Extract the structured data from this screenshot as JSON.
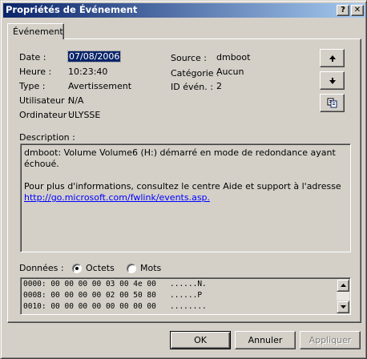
{
  "window": {
    "title": "Propriétés de Événement"
  },
  "titlebar": {
    "help_label": "?",
    "close_label": "✕"
  },
  "tabs": [
    {
      "label": "Événement"
    }
  ],
  "event": {
    "date_label": "Date :",
    "date_value": "07/08/2006",
    "time_label": "Heure :",
    "time_value": "10:23:40",
    "type_label": "Type :",
    "type_value": "Avertissement",
    "user_label": "Utilisateur :",
    "user_value": "N/A",
    "computer_label": "Ordinateur :",
    "computer_value": "ULYSSE",
    "source_label": "Source :",
    "source_value": "dmboot",
    "category_label": "Catégorie :",
    "category_value": "Aucun",
    "event_id_label": "ID évén. :",
    "event_id_value": "2"
  },
  "side_buttons": {
    "up_icon": "arrow-up-icon",
    "down_icon": "arrow-down-icon",
    "copy_icon": "copy-icon"
  },
  "description": {
    "label": "Description :",
    "line1": "dmboot: Volume Volume6 (H:) démarré en mode de redondance ayant échoué.",
    "line2": "Pour plus d'informations, consultez le centre Aide et support à l'adresse",
    "link": "http://go.microsoft.com/fwlink/events.asp."
  },
  "data_section": {
    "label": "Données :",
    "options": [
      {
        "label": "Octets",
        "selected": true
      },
      {
        "label": "Mots",
        "selected": false
      }
    ],
    "rows": [
      "0000: 00 00 00 00 03 00 4e 00   ......N.",
      "0008: 00 00 00 00 02 00 50 80   ......P",
      "0010: 00 00 00 00 00 00 00 00   ........"
    ]
  },
  "footer": {
    "ok": "OK",
    "cancel": "Annuler",
    "apply": "Appliquer"
  },
  "colors": {
    "titlebar_start": "#0a246a",
    "titlebar_end": "#a6caf0",
    "face": "#d4d0c8",
    "link": "#0000ff"
  }
}
